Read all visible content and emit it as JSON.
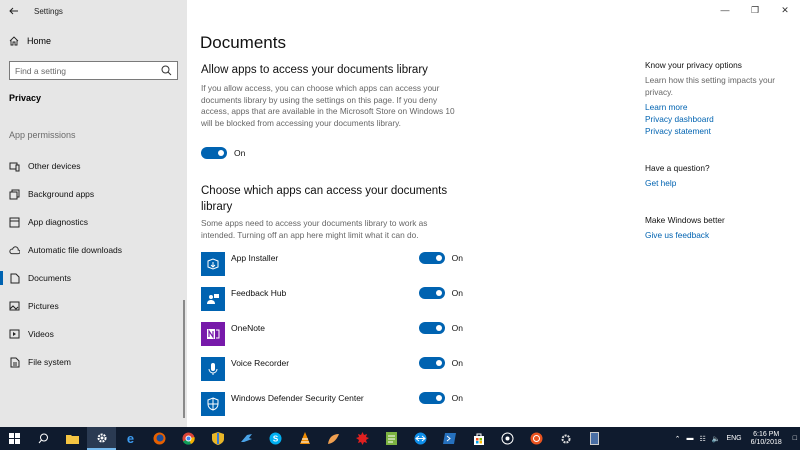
{
  "window": {
    "title": "Settings"
  },
  "sidebar": {
    "home": "Home",
    "search_placeholder": "Find a setting",
    "category": "Privacy",
    "section_label": "App permissions",
    "items": [
      {
        "label": "Other devices",
        "icon": "devices-icon"
      },
      {
        "label": "Background apps",
        "icon": "background-apps-icon"
      },
      {
        "label": "App diagnostics",
        "icon": "app-diagnostics-icon"
      },
      {
        "label": "Automatic file downloads",
        "icon": "cloud-icon"
      },
      {
        "label": "Documents",
        "icon": "document-icon",
        "active": true
      },
      {
        "label": "Pictures",
        "icon": "pictures-icon"
      },
      {
        "label": "Videos",
        "icon": "videos-icon"
      },
      {
        "label": "File system",
        "icon": "file-system-icon"
      }
    ]
  },
  "main": {
    "title": "Documents",
    "allow_heading": "Allow apps to access your documents library",
    "allow_desc": "If you allow access, you can choose which apps can access your documents library by using the settings on this page. If you deny access, apps that are available in the Microsoft Store on Windows 10 will be blocked from accessing your documents library.",
    "master_toggle": {
      "state": "On"
    },
    "choose_heading_line1": "Choose which apps can access your documents",
    "choose_heading_line2": "library",
    "choose_desc": "Some apps need to access your documents library to work as intended. Turning off an app here might limit what it can do.",
    "apps": [
      {
        "name": "App Installer",
        "state": "On",
        "icon": "app-installer-icon"
      },
      {
        "name": "Feedback Hub",
        "state": "On",
        "icon": "feedback-hub-icon"
      },
      {
        "name": "OneNote",
        "state": "On",
        "icon": "onenote-icon"
      },
      {
        "name": "Voice Recorder",
        "state": "On",
        "icon": "voice-recorder-icon"
      },
      {
        "name": "Windows Defender Security Center",
        "state": "On",
        "icon": "shield-icon"
      }
    ]
  },
  "right": {
    "privacy_heading": "Know your privacy options",
    "privacy_text": "Learn how this setting impacts your privacy.",
    "links": [
      "Learn more",
      "Privacy dashboard",
      "Privacy statement"
    ],
    "question_heading": "Have a question?",
    "help_link": "Get help",
    "better_heading": "Make Windows better",
    "feedback_link": "Give us feedback"
  },
  "taskbar": {
    "lang": "ENG",
    "time": "6:16 PM",
    "date": "6/10/2018"
  },
  "colors": {
    "accent": "#0063b1",
    "sidebar_bg": "#e6e6e6",
    "taskbar_bg": "#0f1b2e"
  }
}
